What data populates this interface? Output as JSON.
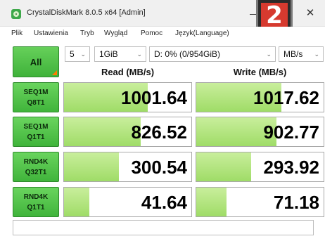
{
  "window": {
    "title": "CrystalDiskMark 8.0.5 x64 [Admin]",
    "minimize_glyph": "—",
    "close_glyph": "✕",
    "badge_number": "2"
  },
  "menu": [
    "Plik",
    "Ustawienia",
    "Tryb",
    "Wygląd",
    "Pomoc",
    "Język(Language)"
  ],
  "controls": {
    "all_label": "All",
    "count": "5",
    "size": "1GiB",
    "drive": "D: 0% (0/954GiB)",
    "unit": "MB/s"
  },
  "columns": {
    "read": "Read (MB/s)",
    "write": "Write (MB/s)"
  },
  "tests": [
    {
      "line1": "SEQ1M",
      "line2": "Q8T1",
      "read": "1001.64",
      "write": "1017.62",
      "read_fill": 0.66,
      "write_fill": 0.67
    },
    {
      "line1": "SEQ1M",
      "line2": "Q1T1",
      "read": "826.52",
      "write": "902.77",
      "read_fill": 0.6,
      "write_fill": 0.63
    },
    {
      "line1": "RND4K",
      "line2": "Q32T1",
      "read": "300.54",
      "write": "293.92",
      "read_fill": 0.43,
      "write_fill": 0.43
    },
    {
      "line1": "RND4K",
      "line2": "Q1T1",
      "read": "41.64",
      "write": "71.18",
      "read_fill": 0.2,
      "write_fill": 0.24
    }
  ],
  "status_text": "",
  "colors": {
    "accent": "#4cc043",
    "bar_fill": "#b4e67f",
    "badge": "#d63a2f"
  }
}
